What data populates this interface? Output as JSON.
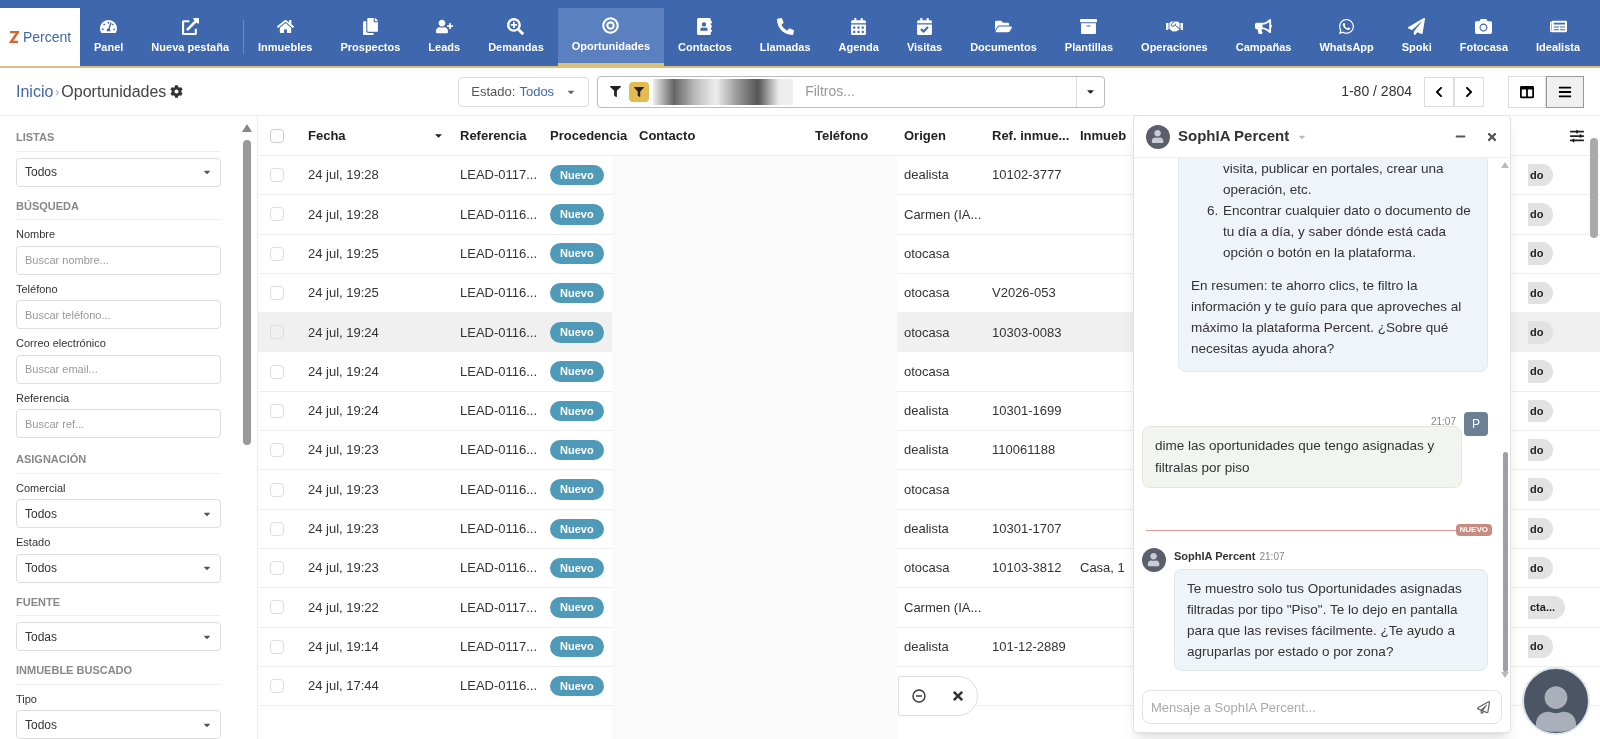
{
  "nav": {
    "logo": "Percent",
    "items": [
      {
        "label": "Panel",
        "selected": false
      },
      {
        "label": "Nueva pestaña",
        "selected": false
      },
      {
        "label": "Inmuebles",
        "selected": false
      },
      {
        "label": "Prospectos",
        "selected": false
      },
      {
        "label": "Leads",
        "selected": false
      },
      {
        "label": "Demandas",
        "selected": false
      },
      {
        "label": "Oportunidades",
        "selected": true
      },
      {
        "label": "Contactos",
        "selected": false
      },
      {
        "label": "Llamadas",
        "selected": false
      },
      {
        "label": "Agenda",
        "selected": false
      },
      {
        "label": "Visitas",
        "selected": false
      },
      {
        "label": "Documentos",
        "selected": false
      },
      {
        "label": "Plantillas",
        "selected": false
      },
      {
        "label": "Operaciones",
        "selected": false
      },
      {
        "label": "Campañas",
        "selected": false
      },
      {
        "label": "WhatsApp",
        "selected": false
      },
      {
        "label": "Spoki",
        "selected": false
      },
      {
        "label": "Fotocasa",
        "selected": false
      },
      {
        "label": "Idealista",
        "selected": false
      }
    ]
  },
  "toolbar": {
    "breadcrumb": [
      "Inicio",
      "›",
      "Oportunidades"
    ],
    "estado_label": "Estado:",
    "estado_value": "Todos",
    "filter_placeholder": "Filtros...",
    "pagination": "1-80 / 2804",
    "views": [
      {
        "kind": "kanban",
        "selected": false
      },
      {
        "kind": "list",
        "selected": true
      }
    ]
  },
  "sidebar": {
    "sections": [
      {
        "title": "LISTAS",
        "fields": [
          {
            "kind": "select",
            "value": "Todos"
          }
        ]
      },
      {
        "title": "BÚSQUEDA",
        "fields": [
          {
            "kind": "input",
            "label": "Nombre",
            "placeholder": "Buscar nombre..."
          },
          {
            "kind": "input",
            "label": "Teléfono",
            "placeholder": "Buscar teléfono..."
          },
          {
            "kind": "input",
            "label": "Correo electrónico",
            "placeholder": "Buscar email..."
          },
          {
            "kind": "input",
            "label": "Referencia",
            "placeholder": "Buscar ref..."
          }
        ]
      },
      {
        "title": "ASIGNACIÓN",
        "fields": [
          {
            "kind": "select",
            "label": "Comercial",
            "value": "Todos"
          },
          {
            "kind": "select",
            "label": "Estado",
            "value": "Todos"
          }
        ]
      },
      {
        "title": "FUENTE",
        "fields": [
          {
            "kind": "select",
            "value": "Todas"
          }
        ]
      },
      {
        "title": "INMUEBLE BUSCADO",
        "fields": [
          {
            "kind": "select",
            "label": "Tipo",
            "value": "Todos"
          }
        ]
      }
    ]
  },
  "table": {
    "select_all_checked": false,
    "columns": [
      "Fecha",
      "Referencia",
      "Procedencia",
      "Contacto",
      "Teléfono",
      "Origen",
      "Ref. inmue...",
      "Inmueb"
    ],
    "rows": [
      {
        "selected": false,
        "fecha": "24 jul, 19:28",
        "referencia": "LEAD-0117...",
        "procedencia": "Nuevo",
        "origen": "dealista",
        "ref_inmueble": "10102-3777",
        "column_9": "do"
      },
      {
        "selected": false,
        "fecha": "24 jul, 19:28",
        "referencia": "LEAD-0116...",
        "procedencia": "Nuevo",
        "origen": "Carmen (IA...",
        "column_9": "do"
      },
      {
        "selected": false,
        "fecha": "24 jul, 19:25",
        "referencia": "LEAD-0116...",
        "procedencia": "Nuevo",
        "origen": "otocasa",
        "column_9": "do"
      },
      {
        "selected": false,
        "fecha": "24 jul, 19:25",
        "referencia": "LEAD-0116...",
        "procedencia": "Nuevo",
        "origen": "otocasa",
        "ref_inmueble": "V2026-053",
        "column_9": "do"
      },
      {
        "selected": true,
        "fecha": "24 jul, 19:24",
        "referencia": "LEAD-0116...",
        "procedencia": "Nuevo",
        "origen": "otocasa",
        "ref_inmueble": "10303-0083",
        "column_9": "do"
      },
      {
        "selected": false,
        "fecha": "24 jul, 19:24",
        "referencia": "LEAD-0116...",
        "procedencia": "Nuevo",
        "origen": "otocasa",
        "column_9": "do"
      },
      {
        "selected": false,
        "fecha": "24 jul, 19:24",
        "referencia": "LEAD-0116...",
        "procedencia": "Nuevo",
        "origen": "dealista",
        "ref_inmueble": "10301-1699",
        "column_9": "do"
      },
      {
        "selected": false,
        "fecha": "24 jul, 19:23",
        "referencia": "LEAD-0116...",
        "procedencia": "Nuevo",
        "origen": "dealista",
        "ref_inmueble": "110061188",
        "column_9": "do"
      },
      {
        "selected": false,
        "fecha": "24 jul, 19:23",
        "referencia": "LEAD-0116...",
        "procedencia": "Nuevo",
        "origen": "otocasa",
        "column_9": "do"
      },
      {
        "selected": false,
        "fecha": "24 jul, 19:23",
        "referencia": "LEAD-0116...",
        "procedencia": "Nuevo",
        "origen": "dealista",
        "ref_inmueble": "10301-1707",
        "column_9": "do"
      },
      {
        "selected": false,
        "fecha": "24 jul, 19:23",
        "referencia": "LEAD-0116...",
        "procedencia": "Nuevo",
        "origen": "otocasa",
        "ref_inmueble": "10103-3812",
        "inmueble": "Casa, 1",
        "column_9": "do"
      },
      {
        "selected": false,
        "fecha": "24 jul, 19:22",
        "referencia": "LEAD-0117...",
        "procedencia": "Nuevo",
        "origen": "Carmen (IA...",
        "column_9": "cta..."
      },
      {
        "selected": false,
        "fecha": "24 jul, 19:14",
        "referencia": "LEAD-0117...",
        "procedencia": "Nuevo",
        "origen": "dealista",
        "ref_inmueble": "101-12-2889",
        "column_9": "do"
      },
      {
        "selected": false,
        "fecha": "24 jul, 17:44",
        "referencia": "LEAD-0116...",
        "procedencia": "Nuevo"
      }
    ]
  },
  "chat": {
    "title": "SophIA Percent",
    "messages": [
      {
        "kind": "bot_tail",
        "list": [
          {
            "text": "visita, publicar en portales, crear una operación, etc."
          },
          {
            "marker": "6.",
            "text": "Encontrar cualquier dato o documento de tu día a día, y saber dónde está cada opción o botón en la plataforma."
          }
        ],
        "text": "En resumen: te ahorro clics, te filtro la información y te guío para que aproveches al máximo la plataforma Percent. ¿Sobre qué necesitas ayuda ahora?"
      },
      {
        "kind": "user",
        "time": "21:07",
        "initial": "P",
        "text": "dime las oportunidades que tengo asignadas y filtralas por piso"
      },
      {
        "kind": "divider",
        "label": "NUEVO"
      },
      {
        "kind": "bot",
        "name": "SophIA Percent",
        "time": "21:07",
        "text": "Te muestro solo tus Oportunidades asignadas filtradas por tipo \"Piso\". Te lo dejo en pantalla para que las revises fácilmente. ¿Te ayudo a agruparlas por estado o por zona?"
      }
    ],
    "input_placeholder": "Mensaje a SophIA Percent..."
  }
}
